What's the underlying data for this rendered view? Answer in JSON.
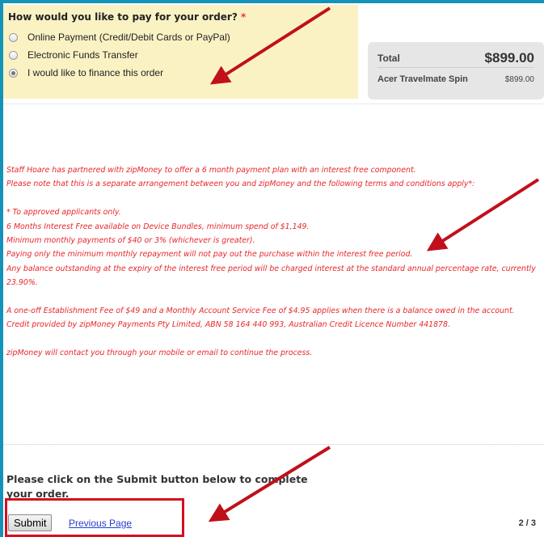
{
  "payment": {
    "question": "How would you like to pay for your order?",
    "required_mark": "*",
    "options": [
      {
        "label": "Online Payment (Credit/Debit Cards or PayPal)",
        "selected": false
      },
      {
        "label": "Electronic Funds Transfer",
        "selected": false
      },
      {
        "label": "I would like to finance this order",
        "selected": true
      }
    ]
  },
  "summary": {
    "total_label": "Total",
    "total_value": "$899.00",
    "item_name": "Acer Travelmate Spin",
    "item_price": "$899.00"
  },
  "terms": {
    "intro1": "Staff Hoare has partnered with zipMoney to offer a 6 month payment plan with an interest free component.",
    "intro2": "Please note that this is a separate arrangement between you and zipMoney and the following terms and conditions apply*:",
    "b1": "* To approved applicants only.",
    "b2": "6 Months Interest Free available on Device Bundles, minimum spend of $1,149.",
    "b3": "Minimum monthly payments of $40 or 3% (whichever is greater).",
    "b4": "Paying only the minimum monthly repayment will not pay out the purchase within the interest free period.",
    "b5": "Any balance outstanding at the expiry of the interest free period will be charged interest at the standard annual percentage rate, currently 23.90%.",
    "fee": "A one-off Establishment Fee of $49 and a Monthly Account Service Fee of $4.95 applies when there is a balance owed in the account.",
    "credit": "Credit provided by zipMoney Payments Pty Limited, ABN 58 164 440 993, Australian Credit Licence Number 441878.",
    "contact": "zipMoney will contact you through your mobile or email to continue the process."
  },
  "footer": {
    "prompt": "Please click on the Submit button below to complete your order.",
    "submit_label": "Submit",
    "previous_label": "Previous Page",
    "page_indicator": "2 / 3"
  },
  "colors": {
    "frame_border": "#1493b8",
    "panel_bg": "#fbf2c4",
    "terms_text": "#e8262a",
    "annotation": "#d4101f"
  }
}
